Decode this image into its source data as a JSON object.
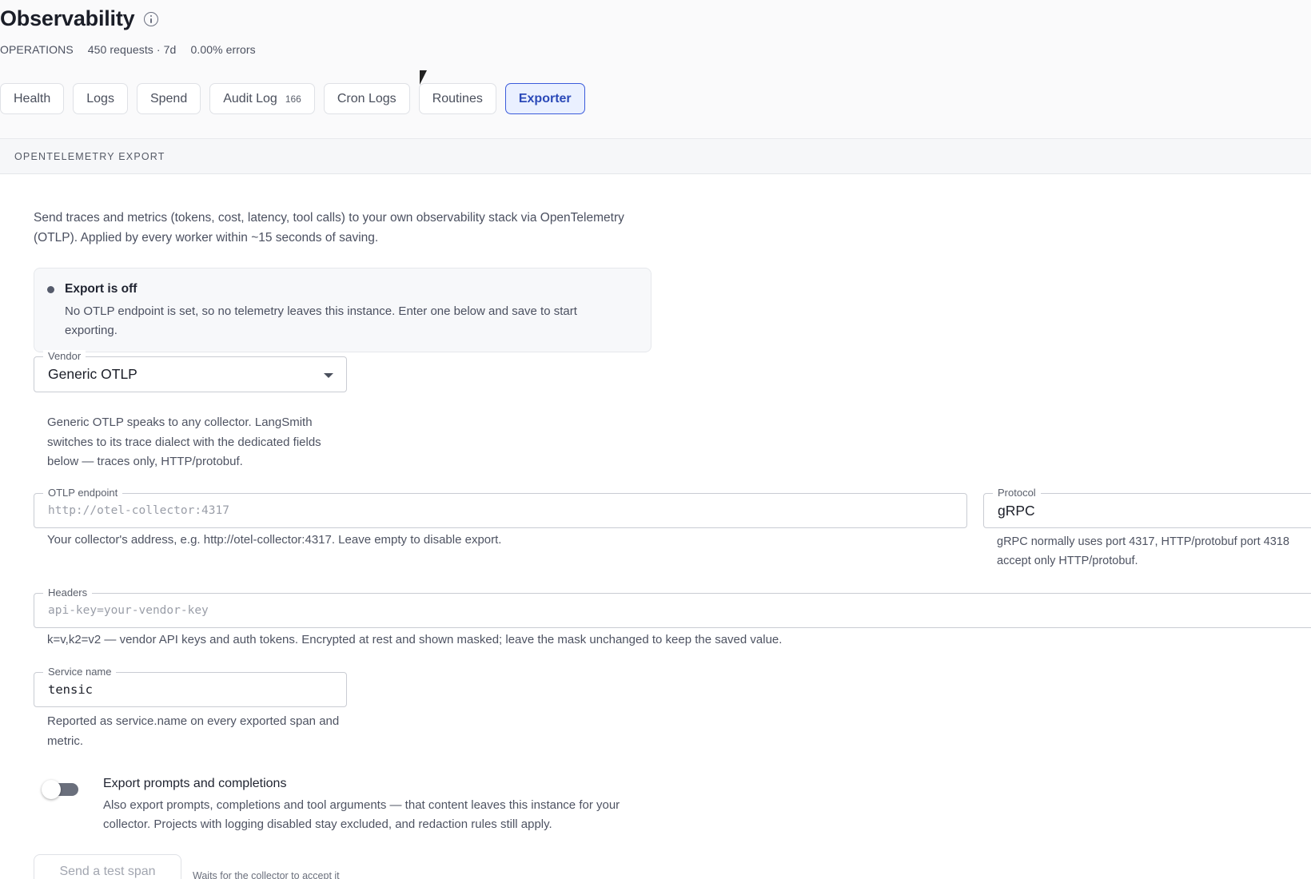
{
  "header": {
    "title": "Observability",
    "meta": [
      "OPERATIONS",
      "450 requests · 7d",
      "0.00% errors"
    ]
  },
  "tabs": [
    {
      "label": "Health"
    },
    {
      "label": "Logs"
    },
    {
      "label": "Spend"
    },
    {
      "label": "Audit Log",
      "count": "166"
    },
    {
      "label": "Cron Logs"
    },
    {
      "label": "Routines"
    },
    {
      "label": "Exporter",
      "active": true
    }
  ],
  "section": {
    "label": "OPENTELEMETRY EXPORT",
    "description": "Send traces and metrics (tokens, cost, latency, tool calls) to your own observability stack via OpenTelemetry (OTLP). Applied by every worker within ~15 seconds of saving."
  },
  "status": {
    "title": "Export is off",
    "body": "No OTLP endpoint is set, so no telemetry leaves this instance. Enter one below and save to start exporting."
  },
  "vendor": {
    "label": "Vendor",
    "value": "Generic OTLP",
    "helper": "Generic OTLP speaks to any collector. LangSmith switches to its trace dialect with the dedicated fields below — traces only, HTTP/protobuf."
  },
  "endpoint": {
    "label": "OTLP endpoint",
    "value": "",
    "placeholder": "http://otel-collector:4317",
    "helper": "Your collector's address, e.g. http://otel-collector:4317. Leave empty to disable export."
  },
  "protocol": {
    "label": "Protocol",
    "value": "gRPC",
    "helper": "gRPC normally uses port 4317, HTTP/protobuf port 4318 accept only HTTP/protobuf."
  },
  "headers": {
    "label": "Headers",
    "value": "",
    "placeholder": "api-key=your-vendor-key",
    "helper": "k=v,k2=v2 — vendor API keys and auth tokens. Encrypted at rest and shown masked; leave the mask unchanged to keep the saved value."
  },
  "service": {
    "label": "Service name",
    "value": "tensic",
    "helper": "Reported as service.name on every exported span and metric."
  },
  "prompts_toggle": {
    "title": "Export prompts and completions",
    "body": "Also export prompts, completions and tool arguments — that content leaves this instance for your collector. Projects with logging disabled stay excluded, and redaction rules still apply.",
    "enabled": false
  },
  "test": {
    "button_label": "Send a test span",
    "hint": "Waits for the collector to accept it"
  },
  "colors": {
    "accent": "#3b5bdb",
    "active_tab_bg": "#eaf0ff"
  }
}
